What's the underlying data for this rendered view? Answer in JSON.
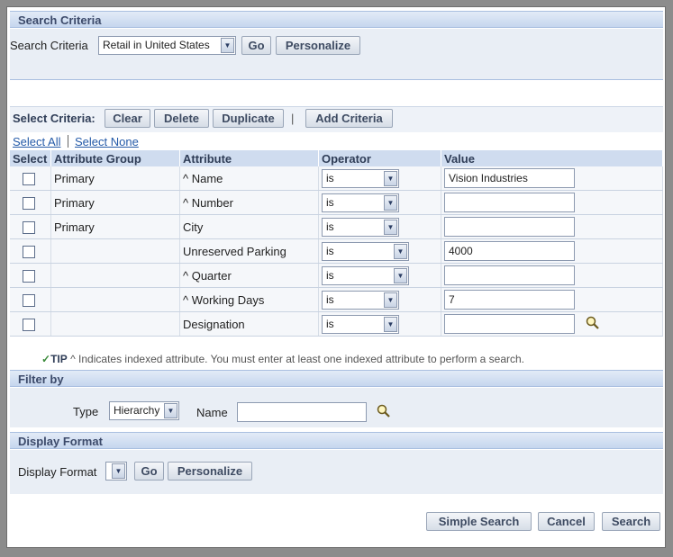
{
  "search_criteria": {
    "header": "Search Criteria",
    "label": "Search Criteria",
    "selected": "Retail in United States",
    "go": "Go",
    "personalize": "Personalize"
  },
  "select_criteria": {
    "label": "Select Criteria:",
    "clear": "Clear",
    "delete": "Delete",
    "duplicate": "Duplicate",
    "separator": "|",
    "add_criteria": "Add Criteria",
    "select_all": "Select All",
    "select_none": "Select None"
  },
  "table": {
    "columns": [
      "Select",
      "Attribute Group",
      "Attribute",
      "Operator",
      "Value"
    ],
    "rows": [
      {
        "group": "Primary",
        "attribute": "^ Name",
        "operator": "is",
        "value": "Vision Industries"
      },
      {
        "group": "Primary",
        "attribute": "^ Number",
        "operator": "is",
        "value": ""
      },
      {
        "group": "Primary",
        "attribute": "City",
        "operator": "is",
        "value": ""
      },
      {
        "group": "",
        "attribute": "Unreserved Parking",
        "operator": "is",
        "value": "4000"
      },
      {
        "group": "",
        "attribute": "^ Quarter",
        "operator": "is",
        "value": ""
      },
      {
        "group": "",
        "attribute": "^ Working Days",
        "operator": "is",
        "value": "7"
      },
      {
        "group": "",
        "attribute": "Designation",
        "operator": "is",
        "value": ""
      }
    ]
  },
  "tip": {
    "label": "TIP",
    "text": "^ Indicates indexed attribute. You must enter at least one indexed attribute to perform a search."
  },
  "filter_by": {
    "header": "Filter by",
    "type_label": "Type",
    "type_value": "Hierarchy",
    "name_label": "Name",
    "name_value": ""
  },
  "display_format": {
    "header": "Display Format",
    "label": "Display Format",
    "value": "",
    "go": "Go",
    "personalize": "Personalize"
  },
  "footer": {
    "simple_search": "Simple Search",
    "cancel": "Cancel",
    "search": "Search"
  },
  "icons": {
    "search": "magnifier-icon",
    "dropdown": "chevron-down-icon",
    "tip": "checkmark-icon"
  }
}
